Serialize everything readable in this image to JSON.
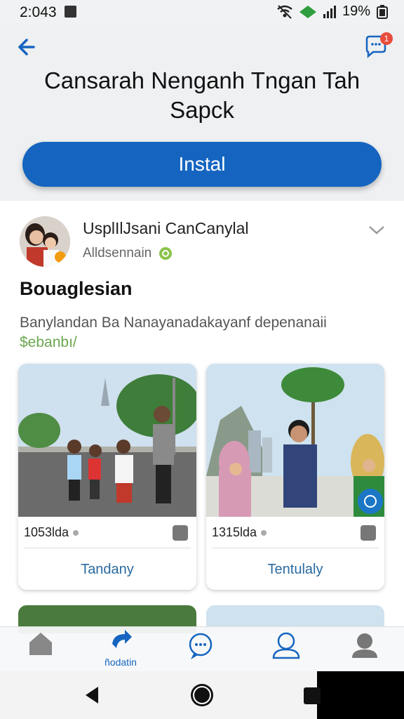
{
  "status": {
    "time": "2:043",
    "battery": "19%"
  },
  "header": {
    "title": "Cansarah Nenganh Tngan Tah Sapck",
    "install_label": "Instal",
    "message_badge": "1"
  },
  "post": {
    "username": "UsplIlJsani CanCanylal",
    "subtitle": "Alldsennain",
    "title": "Bouaglesian",
    "description": "Banylandan Ba Nanayanadakayanf depenanaii",
    "description_tag": "$ebanbı/"
  },
  "cards": [
    {
      "meta": "1053lda",
      "label": "Tandany"
    },
    {
      "meta": "1315lda",
      "label": "Tentulaly"
    }
  ],
  "nav": {
    "active_label": "ñodatin"
  },
  "colors": {
    "accent": "#1565c0",
    "badge": "#e74c3c"
  }
}
